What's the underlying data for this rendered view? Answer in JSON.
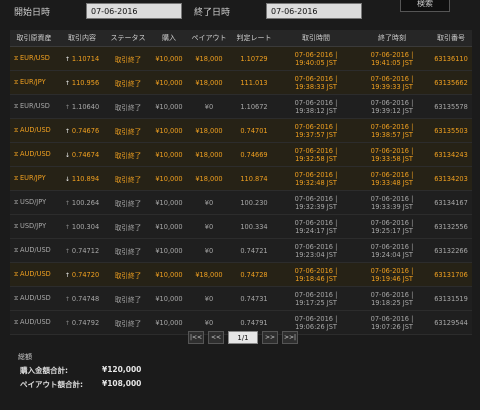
{
  "filter": {
    "start_label": "開始日時",
    "start_value": "07-06-2016",
    "end_label": "終了日時",
    "end_value": "07-06-2016",
    "search_label": "検索"
  },
  "table": {
    "headers": [
      "取引原資産",
      "取引内容",
      "ステータス",
      "購入",
      "ペイアウト",
      "判定レート",
      "取引時間",
      "終了時刻",
      "取引番号"
    ],
    "rows": [
      {
        "result": "win",
        "asset": "EUR/USD",
        "direction": "up",
        "strike": "1.10714",
        "status": "取引終了",
        "purchase": "¥10,000",
        "payout": "¥18,000",
        "closing": "1.10729",
        "time_date": "07-06-2016 |",
        "time_clock": "19:40:05 JST",
        "end_date": "07-06-2016 |",
        "end_clock": "19:41:05 JST",
        "id": "63136110"
      },
      {
        "result": "win",
        "asset": "EUR/JPY",
        "direction": "up",
        "strike": "110.956",
        "status": "取引終了",
        "purchase": "¥10,000",
        "payout": "¥18,000",
        "closing": "111.013",
        "time_date": "07-06-2016 |",
        "time_clock": "19:38:33 JST",
        "end_date": "07-06-2016 |",
        "end_clock": "19:39:33 JST",
        "id": "63135662"
      },
      {
        "result": "lose",
        "asset": "EUR/USD",
        "direction": "up",
        "strike": "1.10640",
        "status": "取引終了",
        "purchase": "¥10,000",
        "payout": "¥0",
        "closing": "1.10672",
        "time_date": "07-06-2016 |",
        "time_clock": "19:38:12 JST",
        "end_date": "07-06-2016 |",
        "end_clock": "19:39:12 JST",
        "id": "63135578"
      },
      {
        "result": "win",
        "asset": "AUD/USD",
        "direction": "up",
        "strike": "0.74676",
        "status": "取引終了",
        "purchase": "¥10,000",
        "payout": "¥18,000",
        "closing": "0.74701",
        "time_date": "07-06-2016 |",
        "time_clock": "19:37:57 JST",
        "end_date": "07-06-2016 |",
        "end_clock": "19:38:57 JST",
        "id": "63135503"
      },
      {
        "result": "win",
        "asset": "AUD/USD",
        "direction": "down",
        "strike": "0.74674",
        "status": "取引終了",
        "purchase": "¥10,000",
        "payout": "¥18,000",
        "closing": "0.74669",
        "time_date": "07-06-2016 |",
        "time_clock": "19:32:58 JST",
        "end_date": "07-06-2016 |",
        "end_clock": "19:33:58 JST",
        "id": "63134243"
      },
      {
        "result": "win",
        "asset": "EUR/JPY",
        "direction": "down",
        "strike": "110.894",
        "status": "取引終了",
        "purchase": "¥10,000",
        "payout": "¥18,000",
        "closing": "110.874",
        "time_date": "07-06-2016 |",
        "time_clock": "19:32:48 JST",
        "end_date": "07-06-2016 |",
        "end_clock": "19:33:48 JST",
        "id": "63134203"
      },
      {
        "result": "lose",
        "asset": "USD/JPY",
        "direction": "up",
        "strike": "100.264",
        "status": "取引終了",
        "purchase": "¥10,000",
        "payout": "¥0",
        "closing": "100.230",
        "time_date": "07-06-2016 |",
        "time_clock": "19:32:39 JST",
        "end_date": "07-06-2016 |",
        "end_clock": "19:33:39 JST",
        "id": "63134167"
      },
      {
        "result": "lose",
        "asset": "USD/JPY",
        "direction": "up",
        "strike": "100.304",
        "status": "取引終了",
        "purchase": "¥10,000",
        "payout": "¥0",
        "closing": "100.334",
        "time_date": "07-06-2016 |",
        "time_clock": "19:24:17 JST",
        "end_date": "07-06-2016 |",
        "end_clock": "19:25:17 JST",
        "id": "63132556"
      },
      {
        "result": "lose",
        "asset": "AUD/USD",
        "direction": "up",
        "strike": "0.74712",
        "status": "取引終了",
        "purchase": "¥10,000",
        "payout": "¥0",
        "closing": "0.74721",
        "time_date": "07-06-2016 |",
        "time_clock": "19:23:04 JST",
        "end_date": "07-06-2016 |",
        "end_clock": "19:24:04 JST",
        "id": "63132266"
      },
      {
        "result": "win",
        "asset": "AUD/USD",
        "direction": "up",
        "strike": "0.74720",
        "status": "取引終了",
        "purchase": "¥10,000",
        "payout": "¥18,000",
        "closing": "0.74728",
        "time_date": "07-06-2016 |",
        "time_clock": "19:18:46 JST",
        "end_date": "07-06-2016 |",
        "end_clock": "19:19:46 JST",
        "id": "63131706"
      },
      {
        "result": "lose",
        "asset": "AUD/USD",
        "direction": "up",
        "strike": "0.74748",
        "status": "取引終了",
        "purchase": "¥10,000",
        "payout": "¥0",
        "closing": "0.74731",
        "time_date": "07-06-2016 |",
        "time_clock": "19:17:25 JST",
        "end_date": "07-06-2016 |",
        "end_clock": "19:18:25 JST",
        "id": "63131519"
      },
      {
        "result": "lose",
        "asset": "AUD/USD",
        "direction": "up",
        "strike": "0.74792",
        "status": "取引終了",
        "purchase": "¥10,000",
        "payout": "¥0",
        "closing": "0.74791",
        "time_date": "07-06-2016 |",
        "time_clock": "19:06:26 JST",
        "end_date": "07-06-2016 |",
        "end_clock": "19:07:26 JST",
        "id": "63129544"
      }
    ]
  },
  "pager": {
    "first": "|<<",
    "prev": "<<",
    "page": "1/1",
    "next": ">>",
    "last": ">>|"
  },
  "summary": {
    "title": "総額",
    "purchase_label": "購入金額合計:",
    "purchase_value": "¥120,000",
    "payout_label": "ペイアウト額合計:",
    "payout_value": "¥108,000"
  },
  "colors": {
    "win_text": "#f0a020",
    "lose_text": "#a8a8a8",
    "background": "#1b1b1b"
  },
  "icons": {
    "asset": "hourglass-icon",
    "up": "arrow-up-icon",
    "down": "arrow-down-icon"
  }
}
